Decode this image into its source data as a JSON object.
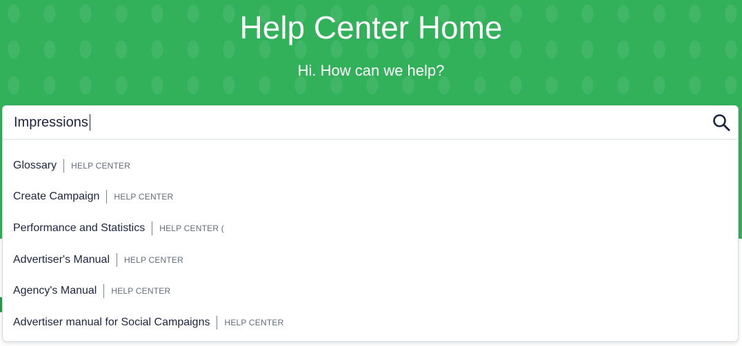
{
  "header": {
    "title": "Help Center Home",
    "subtitle": "Hi. How can we help?"
  },
  "search": {
    "value": "Impressions",
    "icon": "search-icon"
  },
  "results": [
    {
      "title": "Glossary",
      "source": "HELP CENTER"
    },
    {
      "title": "Create Campaign",
      "source": "HELP CENTER"
    },
    {
      "title": "Performance and Statistics",
      "source": "HELP CENTER ("
    },
    {
      "title": "Advertiser's Manual",
      "source": "HELP CENTER"
    },
    {
      "title": "Agency's Manual",
      "source": "HELP CENTER"
    },
    {
      "title": "Advertiser manual for Social Campaigns",
      "source": "HELP CENTER"
    }
  ],
  "colors": {
    "hero_green": "#32b05a",
    "text_dark": "#1b2440",
    "text_muted": "#5f6b7a"
  }
}
